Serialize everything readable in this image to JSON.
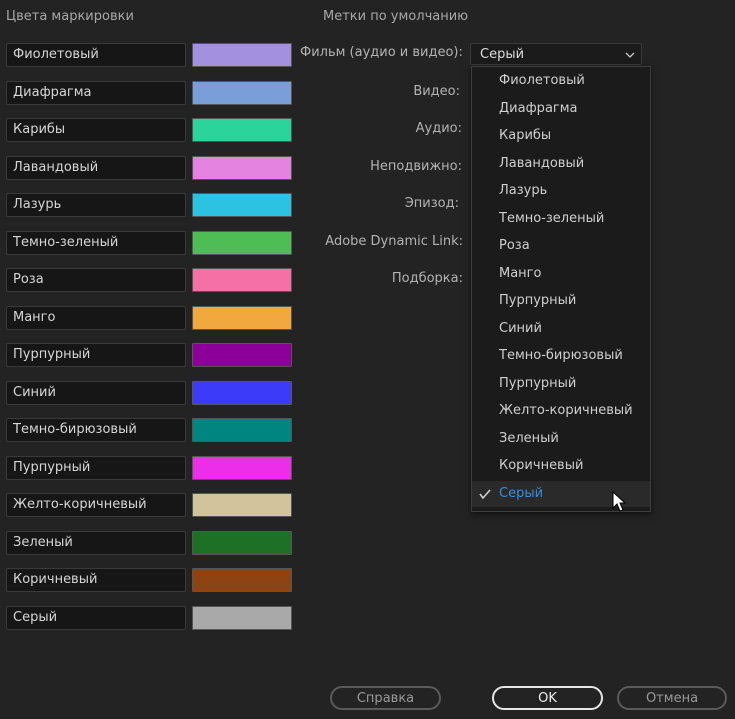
{
  "left_panel": {
    "title": "Цвета маркировки",
    "labels": [
      {
        "name": "Фиолетовый",
        "color": "#A391E0"
      },
      {
        "name": "Диафрагма",
        "color": "#7A9ED8"
      },
      {
        "name": "Карибы",
        "color": "#2BD49A"
      },
      {
        "name": "Лавандовый",
        "color": "#E483E0"
      },
      {
        "name": "Лазурь",
        "color": "#2DC2E2"
      },
      {
        "name": "Темно-зеленый",
        "color": "#4FBD56"
      },
      {
        "name": "Роза",
        "color": "#F470A5"
      },
      {
        "name": "Манго",
        "color": "#F1A93F"
      },
      {
        "name": "Пурпурный",
        "color": "#8C0099"
      },
      {
        "name": "Синий",
        "color": "#3B3BF8"
      },
      {
        "name": "Темно-бирюзовый",
        "color": "#008581"
      },
      {
        "name": "Пурпурный",
        "color": "#EC2EE9"
      },
      {
        "name": "Желто-коричневый",
        "color": "#D2C39C"
      },
      {
        "name": "Зеленый",
        "color": "#1E7026"
      },
      {
        "name": "Коричневый",
        "color": "#8E4313"
      },
      {
        "name": "Серый",
        "color": "#A9A9A9"
      }
    ]
  },
  "right_panel": {
    "title": "Метки по умолчанию",
    "fields": {
      "film": "Фильм (аудио и видео):",
      "video": "Видео:",
      "audio": "Аудио:",
      "still": "Неподвижно:",
      "episode": "Эпизод:",
      "dynamic_link": "Adobe Dynamic Link:",
      "bin": "Подборка:"
    },
    "film_select": {
      "value": "Серый",
      "icon": "chevron-down-icon"
    },
    "dropdown": {
      "options": [
        "Фиолетовый",
        "Диафрагма",
        "Карибы",
        "Лавандовый",
        "Лазурь",
        "Темно-зеленый",
        "Роза",
        "Манго",
        "Пурпурный",
        "Синий",
        "Темно-бирюзовый",
        "Пурпурный",
        "Желто-коричневый",
        "Зеленый",
        "Коричневый",
        "Серый"
      ],
      "selected_index": 15,
      "selected_color": "#3A8DDE"
    }
  },
  "buttons": {
    "help": "Справка",
    "ok": "OK",
    "cancel": "Отмена"
  }
}
